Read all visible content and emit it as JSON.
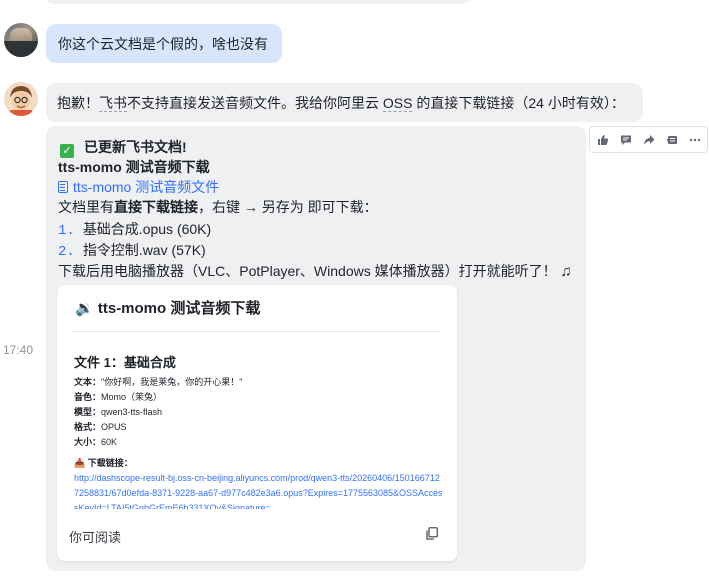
{
  "messages": {
    "user_message": "你这个云文档是个假的，啥也没有",
    "bot_reply_1": {
      "part1": "抱歉！",
      "feishu": "飞书",
      "part2": "不支持直接发送音频文件。我给你阿里云 ",
      "oss": "OSS",
      "part3": " 的直接下载链接（24 小时有效）："
    },
    "bot_reply_2": {
      "updated_title": "已更新飞书文档!",
      "heading": "tts-momo 测试音频下载",
      "doc_link": "tts-momo 测试音频文件",
      "instruction_prefix": "文档里有",
      "instruction_bold": "直接下载链接",
      "instruction_suffix": "，右键 → 另存为 即可下载：",
      "items": [
        {
          "num": "1.",
          "text": "基础合成.opus (60K)"
        },
        {
          "num": "2.",
          "text": "指令控制.wav (57K)"
        }
      ],
      "footer_text": "下载后用电脑播放器（VLC、PotPlayer、Windows 媒体播放器）打开就能听了！"
    },
    "timestamp": "17:40"
  },
  "card": {
    "title_icon": "🔉",
    "title": "tts-momo 测试音频下载",
    "file_heading": "文件 1：基础合成",
    "fields": [
      {
        "label": "文本：",
        "value": "\"你好啊，我是莱兔，你的开心果！\""
      },
      {
        "label": "音色：",
        "value": "Momo（茉兔）"
      },
      {
        "label": "模型：",
        "value": "qwen3-tts-flash"
      },
      {
        "label": "格式：",
        "value": "OPUS"
      },
      {
        "label": "大小：",
        "value": "60K"
      }
    ],
    "download_icon": "📥",
    "download_label": "下载链接：",
    "download_url": "http://dashscope-result-bj.oss-cn-beijing.aliyuncs.com/prod/qwen3-tts/20260406/1501667127258831/67d0efda-8371-9228-aa67-d977c482e3a6.opus?Expires=1775563085&OSSAccessKeyId=LTAI5tGnhGrEmE6h331XQv&Signature=...",
    "footer": "你可阅读"
  },
  "toolbar": {
    "icons": [
      "thumbs-up-icon",
      "comment-icon",
      "forward-icon",
      "reply-icon",
      "more-icon"
    ]
  },
  "colors": {
    "user_bubble": "#d8e6fd",
    "bot_bubble": "#eff0f1",
    "link": "#3370ff",
    "check": "#36b14b"
  }
}
